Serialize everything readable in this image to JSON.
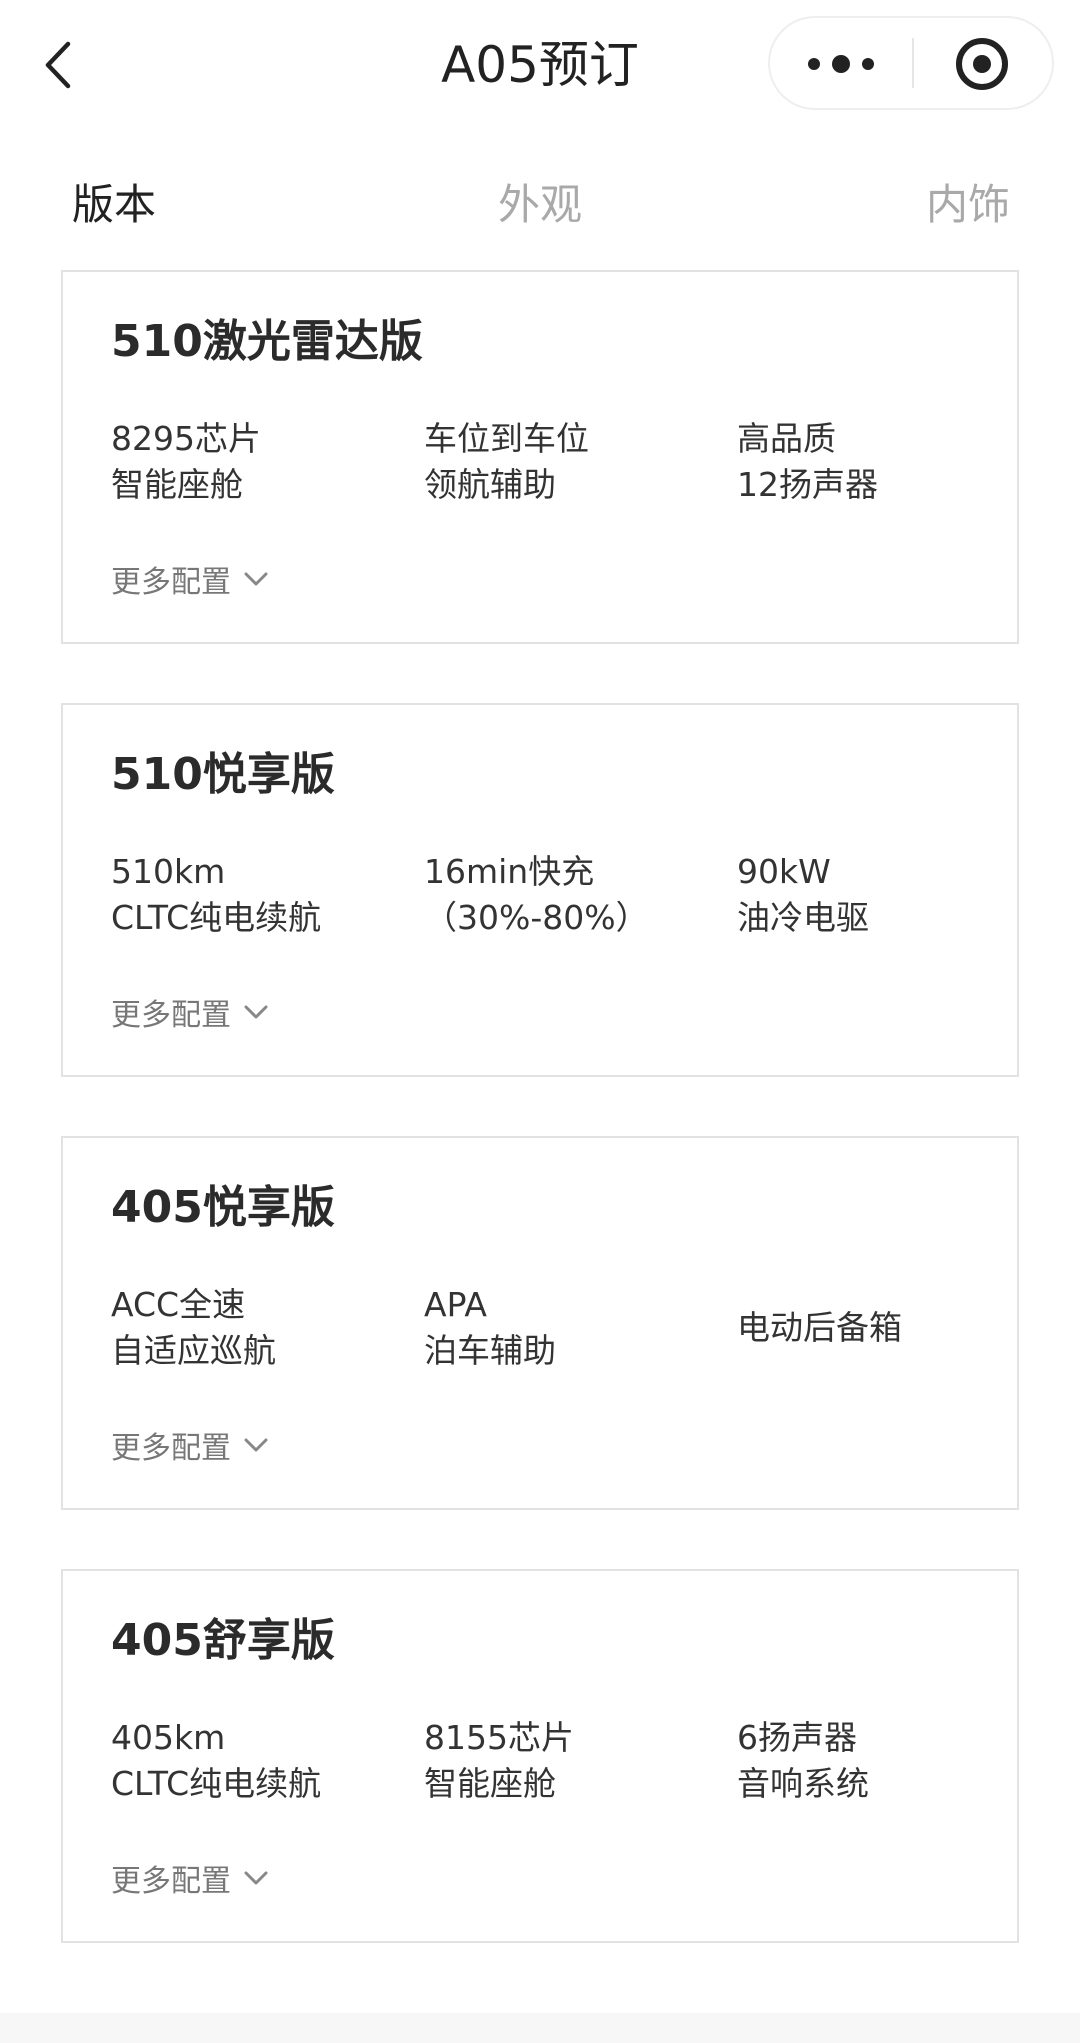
{
  "header": {
    "title": "A05预订",
    "back_icon": "chevron-left-icon",
    "more_icon": "more-dots-icon",
    "close_icon": "target-circle-icon"
  },
  "tabs": [
    {
      "label": "版本",
      "active": true
    },
    {
      "label": "外观",
      "active": false
    },
    {
      "label": "内饰",
      "active": false
    }
  ],
  "cards": [
    {
      "title": "510激光雷达版",
      "features": [
        [
          "8295芯片",
          "智能座舱"
        ],
        [
          "车位到车位",
          "领航辅助"
        ],
        [
          "高品质",
          "12扬声器"
        ]
      ],
      "more": "更多配置"
    },
    {
      "title": "510悦享版",
      "features": [
        [
          "510km",
          "CLTC纯电续航"
        ],
        [
          "16min快充",
          "（30%-80%）"
        ],
        [
          "90kW",
          "油冷电驱"
        ]
      ],
      "more": "更多配置"
    },
    {
      "title": "405悦享版",
      "features": [
        [
          "ACC全速",
          "自适应巡航"
        ],
        [
          "APA",
          "泊车辅助"
        ],
        [
          "电动后备箱"
        ]
      ],
      "more": "更多配置"
    },
    {
      "title": "405舒享版",
      "features": [
        [
          "405km",
          "CLTC纯电续航"
        ],
        [
          "8155芯片",
          "智能座舱"
        ],
        [
          "6扬声器",
          "音响系统"
        ]
      ],
      "more": "更多配置"
    }
  ],
  "colors": {
    "text_primary": "#222222",
    "tab_inactive": "#a9a9a9",
    "card_border": "#e2e2e2"
  }
}
